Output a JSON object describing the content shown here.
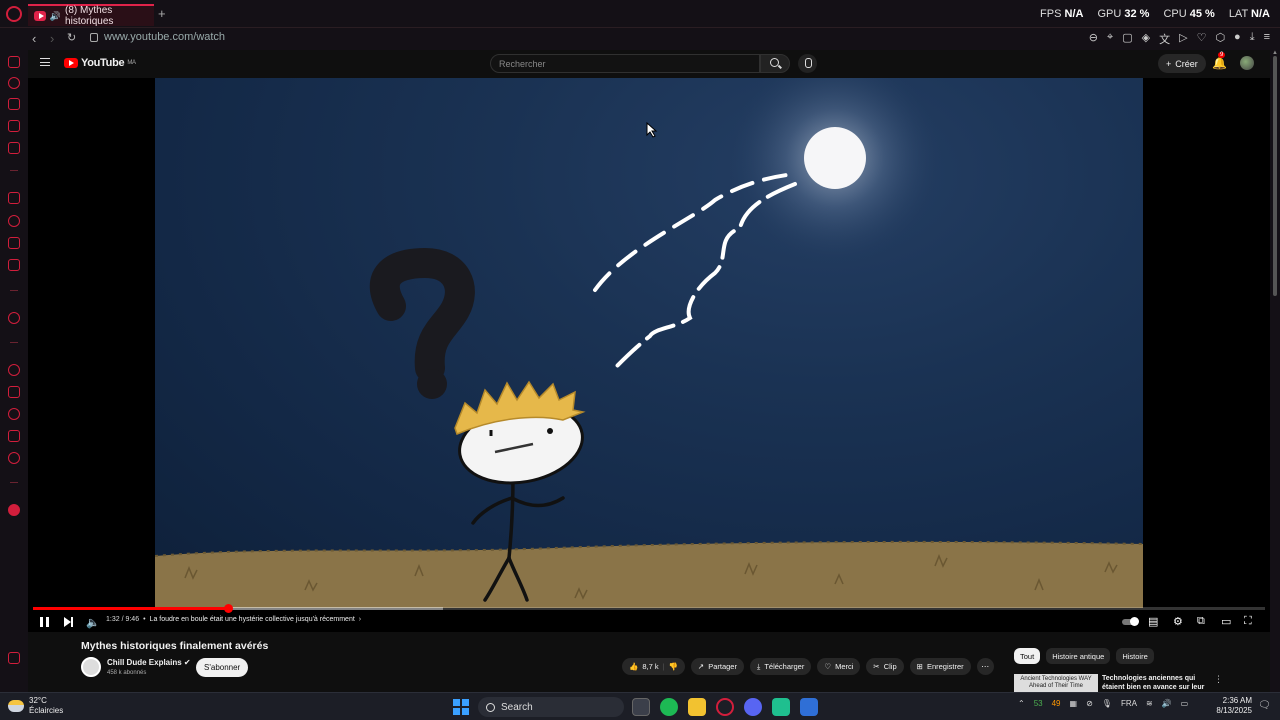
{
  "browser": {
    "tab_title": "(8) Mythes historiques",
    "new_tab": "+",
    "url": "www.youtube.com/watch",
    "hud": [
      {
        "label": "FPS",
        "value": "N/A"
      },
      {
        "label": "GPU",
        "value": "32 %"
      },
      {
        "label": "CPU",
        "value": "45 %"
      },
      {
        "label": "LAT",
        "value": "N/A"
      }
    ]
  },
  "youtube": {
    "logo": "YouTube",
    "region": "MA",
    "search_placeholder": "Rechercher",
    "create_label": "Créer",
    "notif_count": "9"
  },
  "player": {
    "time": "1:32 / 9:46",
    "chapter": "La foudre en boule était une hystérie collective jusqu'à récemment",
    "progress_played": 0.158,
    "progress_buffered": 0.333
  },
  "video": {
    "title": "Mythes historiques finalement avérés",
    "channel": "Chill Dude Explains",
    "subscribers": "458 k abonnés",
    "subscribe": "S'abonner",
    "likes": "8,7 k",
    "share": "Partager",
    "download": "Télécharger",
    "thanks": "Merci",
    "clip": "Clip",
    "save": "Enregistrer"
  },
  "chips": [
    "Tout",
    "Histoire antique",
    "Histoire"
  ],
  "recommendation": {
    "thumb_text": "Ancient Technologies WAY Ahead of Their Time",
    "title": "Technologies anciennes qui étaient bien en avance sur leur"
  },
  "taskbar": {
    "temp": "32°C",
    "weather": "Éclaircies",
    "search": "Search",
    "lang": "FRA",
    "time": "2:36 AM",
    "date": "8/13/2025",
    "tray_a": "53",
    "tray_b": "49"
  },
  "colors": {
    "opera_accent": "#d21e3c",
    "youtube_red": "#ff0000",
    "sky": "#132846",
    "ground": "#8a7448"
  }
}
